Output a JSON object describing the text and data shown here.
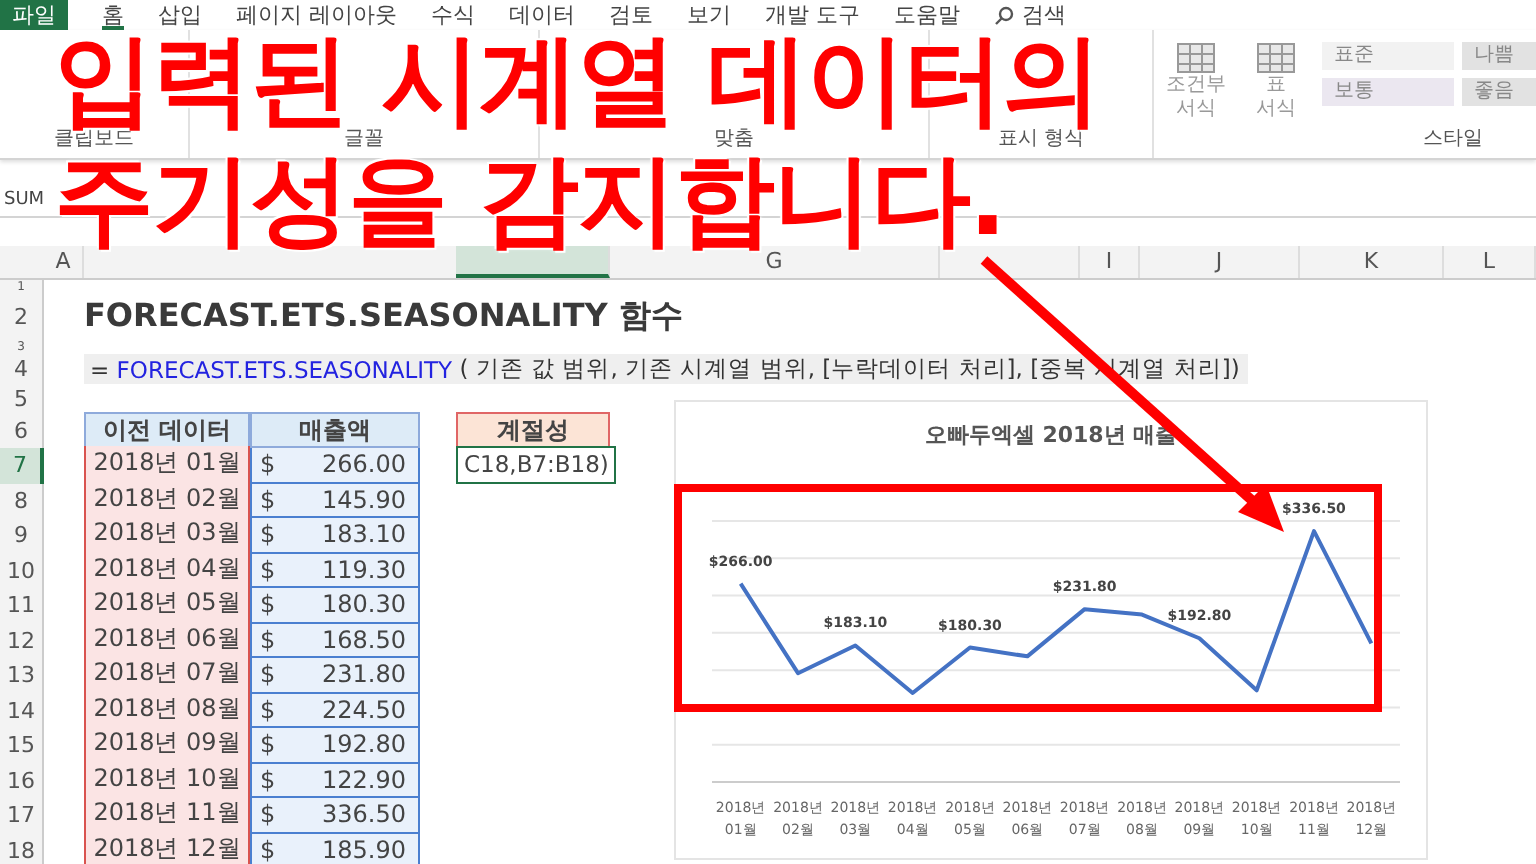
{
  "caption": {
    "lines": [
      "입력된 시계열 데이터의",
      "주기성을 감지합니다."
    ]
  },
  "ribbon": {
    "tabs": [
      {
        "label": "파일",
        "kind": "file",
        "selected": false
      },
      {
        "label": "홈",
        "kind": "tab",
        "selected": true
      },
      {
        "label": "삽입",
        "kind": "tab",
        "selected": false
      },
      {
        "label": "페이지 레이아웃",
        "kind": "tab",
        "selected": false
      },
      {
        "label": "수식",
        "kind": "tab",
        "selected": false
      },
      {
        "label": "데이터",
        "kind": "tab",
        "selected": false
      },
      {
        "label": "검토",
        "kind": "tab",
        "selected": false
      },
      {
        "label": "보기",
        "kind": "tab",
        "selected": false
      },
      {
        "label": "개발 도구",
        "kind": "tab",
        "selected": false
      },
      {
        "label": "도움말",
        "kind": "tab",
        "selected": false
      }
    ],
    "search": "검색",
    "groups": [
      "클립보드",
      "글꼴",
      "맞춤",
      "표시 형식",
      "스타일"
    ],
    "style_buttons": [
      {
        "top": "조건부",
        "bottom": "서식"
      },
      {
        "top": "표",
        "bottom": "서식"
      }
    ],
    "cell_styles": [
      {
        "label": "표준",
        "color": "#f2f2f2"
      },
      {
        "label": "나쁨",
        "color": "#e2e2e2"
      },
      {
        "label": "보통",
        "color": "#ebe7f0"
      },
      {
        "label": "좋음",
        "color": "#e2e2e2"
      }
    ]
  },
  "name_box": "SUM",
  "column_headers": [
    {
      "label": "A",
      "selected": false
    },
    {
      "selected": true
    },
    {
      "label": "G",
      "selected": false
    },
    {
      "selected": false
    },
    {
      "label": "I",
      "selected": false
    },
    {
      "label": "J",
      "selected": false
    },
    {
      "label": "K",
      "selected": false
    },
    {
      "label": "L",
      "selected": false
    }
  ],
  "row_numbers": [
    {
      "label": "1",
      "selected": false
    },
    {
      "label": "2",
      "selected": false
    },
    {
      "label": "3",
      "selected": false
    },
    {
      "label": "4",
      "selected": false
    },
    {
      "label": "5",
      "selected": false
    },
    {
      "label": "6",
      "selected": false
    },
    {
      "label": "7",
      "selected": true
    },
    {
      "label": "8",
      "selected": false
    },
    {
      "label": "9",
      "selected": false
    },
    {
      "label": "10",
      "selected": false
    },
    {
      "label": "11",
      "selected": false
    },
    {
      "label": "12",
      "selected": false
    },
    {
      "label": "13",
      "selected": false
    },
    {
      "label": "14",
      "selected": false
    },
    {
      "label": "15",
      "selected": false
    },
    {
      "label": "16",
      "selected": false
    },
    {
      "label": "17",
      "selected": false
    },
    {
      "label": "18",
      "selected": false
    }
  ],
  "sheet_title": "FORECAST.ETS.SEASONALITY 함수",
  "syntax": {
    "prefix": "=",
    "function": "FORECAST.ETS.SEASONALITY",
    "args": "( 기존 값 범위, 기존 시계열 범위, [누락데이터 처리], [중복 시계열 처리])"
  },
  "table": {
    "columns": [
      "이전 데이터",
      "매출액"
    ],
    "rows": [
      {
        "date": "2018년 01월",
        "currency": "$",
        "amount": "266.00"
      },
      {
        "date": "2018년 02월",
        "currency": "$",
        "amount": "145.90"
      },
      {
        "date": "2018년 03월",
        "currency": "$",
        "amount": "183.10"
      },
      {
        "date": "2018년 04월",
        "currency": "$",
        "amount": "119.30"
      },
      {
        "date": "2018년 05월",
        "currency": "$",
        "amount": "180.30"
      },
      {
        "date": "2018년 06월",
        "currency": "$",
        "amount": "168.50"
      },
      {
        "date": "2018년 07월",
        "currency": "$",
        "amount": "231.80"
      },
      {
        "date": "2018년 08월",
        "currency": "$",
        "amount": "224.50"
      },
      {
        "date": "2018년 09월",
        "currency": "$",
        "amount": "192.80"
      },
      {
        "date": "2018년 10월",
        "currency": "$",
        "amount": "122.90"
      },
      {
        "date": "2018년 11월",
        "currency": "$",
        "amount": "336.50"
      },
      {
        "date": "2018년 12월",
        "currency": "$",
        "amount": "185.90"
      }
    ]
  },
  "seasonality": {
    "header": "계절성",
    "value": "C18,B7:B18)"
  },
  "chart": {
    "chart_data": {
      "type": "line",
      "title": "오빠두엑셀 2018년 매출",
      "categories": [
        "2018년 01월",
        "2018년 02월",
        "2018년 03월",
        "2018년 04월",
        "2018년 05월",
        "2018년 06월",
        "2018년 07월",
        "2018년 08월",
        "2018년 09월",
        "2018년 10월",
        "2018년 11월",
        "2018년 12월"
      ],
      "series": [
        {
          "color": "#4472c4",
          "values": [
            266,
            145.9,
            183.1,
            119.3,
            180.3,
            168.5,
            231.8,
            224.5,
            192.8,
            122.9,
            336.5,
            185.9
          ],
          "value_labels": [
            "$266.00",
            null,
            "$183.10",
            null,
            "$180.30",
            null,
            "$231.80",
            null,
            "$192.80",
            null,
            "$336.50",
            null
          ]
        }
      ]
    }
  }
}
